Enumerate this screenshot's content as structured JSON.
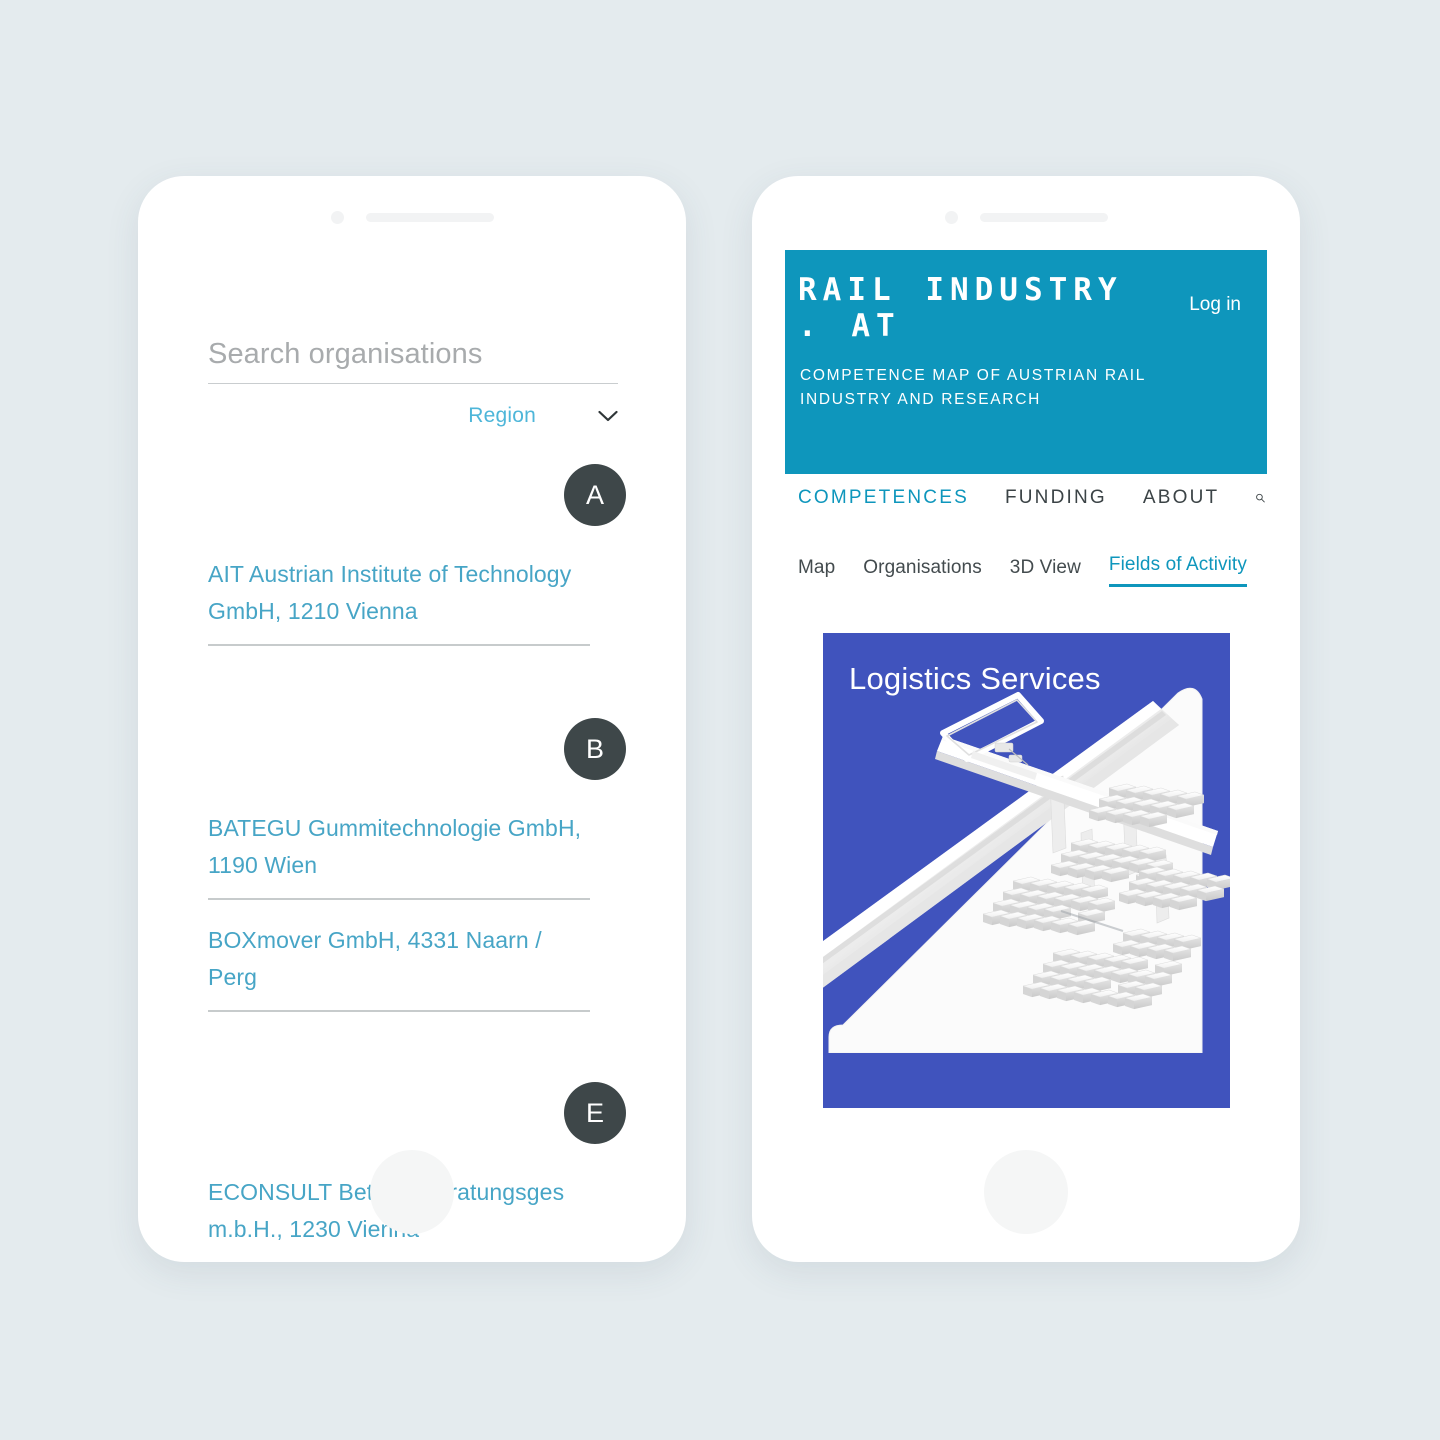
{
  "background_color": "#e4ebee",
  "left_phone": {
    "name": "organisations-search-screen",
    "search": {
      "placeholder": "Search organisations",
      "value": ""
    },
    "filter": {
      "label": "Region",
      "icon": "chevron-down-icon"
    },
    "groups": [
      {
        "letter": "A",
        "items": [
          {
            "name": "AIT Austrian Institute of Technology GmbH, 1210 Vienna"
          }
        ]
      },
      {
        "letter": "B",
        "items": [
          {
            "name": "BATEGU Gummitechnologie GmbH, 1190 Wien"
          },
          {
            "name": "BOXmover GmbH, 4331 Naarn / Perg"
          }
        ]
      },
      {
        "letter": "E",
        "items": [
          {
            "name": "ECONSULT Betriebsberatungsges m.b.H., 1230 Vienna"
          }
        ]
      }
    ],
    "colors": {
      "link": "#47a5c6",
      "badge": "#3e4749",
      "region": "#4eb6d9"
    }
  },
  "right_phone": {
    "name": "competence-map-screen",
    "header": {
      "title": "RAIL INDUSTRY . AT",
      "subtitle": "COMPETENCE MAP OF AUSTRIAN RAIL INDUSTRY AND RESEARCH",
      "login_label": "Log in",
      "background_color": "#0e96bc"
    },
    "main_nav": [
      {
        "label": "COMPETENCES",
        "active": true
      },
      {
        "label": "FUNDING",
        "active": false
      },
      {
        "label": "ABOUT",
        "active": false
      }
    ],
    "main_nav_icon": "search-icon",
    "sub_nav": [
      {
        "label": "Map",
        "active": false
      },
      {
        "label": "Organisations",
        "active": false
      },
      {
        "label": "3D View",
        "active": false
      },
      {
        "label": "Fields of Activity",
        "active": true
      }
    ],
    "card": {
      "title": "Logistics Services",
      "background_color": "#4053bd",
      "illustration": "container-terminal-3d-render"
    }
  }
}
